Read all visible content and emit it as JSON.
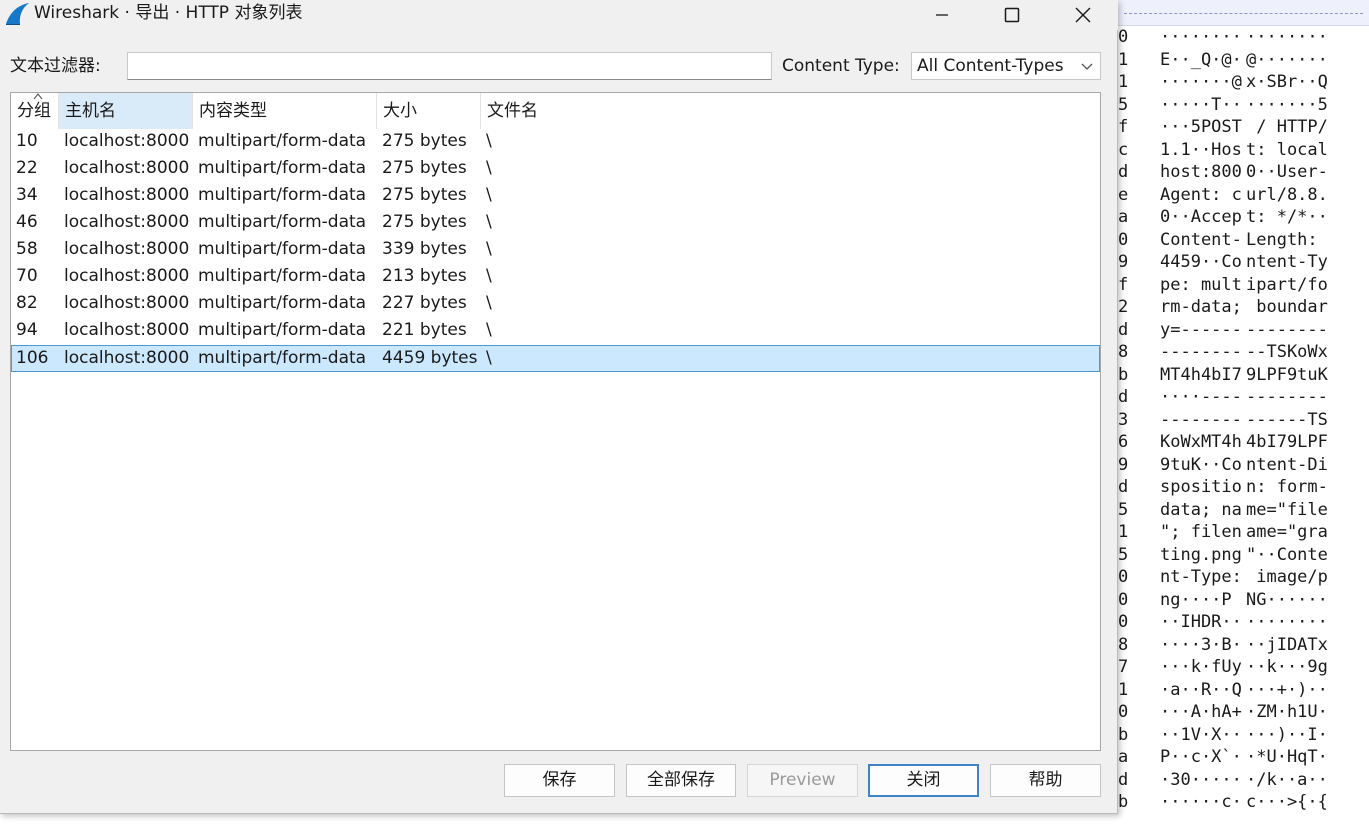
{
  "dialog": {
    "title": "Wireshark · 导出 · HTTP 对象列表",
    "filter_label": "文本过滤器:",
    "filter_value": "",
    "content_type_label": "Content Type:",
    "content_type_selected": "All Content-Types",
    "columns": [
      "分组",
      "主机名",
      "内容类型",
      "大小",
      "文件名"
    ],
    "rows": [
      {
        "packet": "10",
        "host": "localhost:8000",
        "type": "multipart/form-data",
        "size": "275 bytes",
        "filename": "\\"
      },
      {
        "packet": "22",
        "host": "localhost:8000",
        "type": "multipart/form-data",
        "size": "275 bytes",
        "filename": "\\"
      },
      {
        "packet": "34",
        "host": "localhost:8000",
        "type": "multipart/form-data",
        "size": "275 bytes",
        "filename": "\\"
      },
      {
        "packet": "46",
        "host": "localhost:8000",
        "type": "multipart/form-data",
        "size": "275 bytes",
        "filename": "\\"
      },
      {
        "packet": "58",
        "host": "localhost:8000",
        "type": "multipart/form-data",
        "size": "339 bytes",
        "filename": "\\"
      },
      {
        "packet": "70",
        "host": "localhost:8000",
        "type": "multipart/form-data",
        "size": "213 bytes",
        "filename": "\\"
      },
      {
        "packet": "82",
        "host": "localhost:8000",
        "type": "multipart/form-data",
        "size": "227 bytes",
        "filename": "\\"
      },
      {
        "packet": "94",
        "host": "localhost:8000",
        "type": "multipart/form-data",
        "size": "221 bytes",
        "filename": "\\"
      },
      {
        "packet": "106",
        "host": "localhost:8000",
        "type": "multipart/form-data",
        "size": "4459 bytes",
        "filename": "\\"
      }
    ],
    "selected_row": 8,
    "buttons": {
      "save": "保存",
      "save_all": "全部保存",
      "preview": "Preview",
      "close": "关闭",
      "help": "帮助"
    }
  },
  "hex_pane": {
    "lines": [
      {
        "off": "0",
        "a1": "········",
        "a2": "········"
      },
      {
        "off": "1",
        "a1": "E··_Q·@·",
        "a2": "@·······"
      },
      {
        "off": "1",
        "a1": "·······@",
        "a2": "x·SBr··Q"
      },
      {
        "off": "5",
        "a1": "·····T··",
        "a2": "·······5"
      },
      {
        "off": "f",
        "a1": "···5POST",
        "a2": " / HTTP/"
      },
      {
        "off": "c",
        "a1": "1.1··Hos",
        "a2": "t: local"
      },
      {
        "off": "d",
        "a1": "host:800",
        "a2": "0··User-"
      },
      {
        "off": "e",
        "a1": "Agent: c",
        "a2": "url/8.8."
      },
      {
        "off": "a",
        "a1": "0··Accep",
        "a2": "t: */*··"
      },
      {
        "off": "0",
        "a1": "Content-",
        "a2": "Length: "
      },
      {
        "off": "9",
        "a1": "4459··Co",
        "a2": "ntent-Ty"
      },
      {
        "off": "f",
        "a1": "pe: mult",
        "a2": "ipart/fo"
      },
      {
        "off": "2",
        "a1": "rm-data;",
        "a2": " boundar"
      },
      {
        "off": "d",
        "a1": "y=------",
        "a2": "--------"
      },
      {
        "off": "8",
        "a1": "--------",
        "a2": "--TSKoWx"
      },
      {
        "off": "b",
        "a1": "MT4h4bI7",
        "a2": "9LPF9tuK"
      },
      {
        "off": "d",
        "a1": "····----",
        "a2": "--------"
      },
      {
        "off": "3",
        "a1": "--------",
        "a2": "------TS"
      },
      {
        "off": "6",
        "a1": "KoWxMT4h",
        "a2": "4bI79LPF"
      },
      {
        "off": "9",
        "a1": "9tuK··Co",
        "a2": "ntent-Di"
      },
      {
        "off": "d",
        "a1": "spositio",
        "a2": "n: form-"
      },
      {
        "off": "5",
        "a1": "data; na",
        "a2": "me=\"file"
      },
      {
        "off": "1",
        "a1": "\"; filen",
        "a2": "ame=\"gra"
      },
      {
        "off": "5",
        "a1": "ting.png",
        "a2": "\"··Conte"
      },
      {
        "off": "0",
        "a1": "nt-Type:",
        "a2": " image/p"
      },
      {
        "off": "0",
        "a1": "ng····P",
        "a2": "NG······"
      },
      {
        "off": "0",
        "a1": "··IHDR··",
        "a2": "········"
      },
      {
        "off": "8",
        "a1": "····3·B·",
        "a2": "··jIDATx"
      },
      {
        "off": "7",
        "a1": "···k·fUy",
        "a2": "··k···9g"
      },
      {
        "off": "1",
        "a1": "·a··R··Q",
        "a2": "···+·)··"
      },
      {
        "off": "0",
        "a1": "···A·hA+",
        "a2": "·ZM·h1U·"
      },
      {
        "off": "b",
        "a1": "··1V·X··",
        "a2": "···)··I·"
      },
      {
        "off": "a",
        "a1": "P··c·X`·",
        "a2": "·*U·HqT·"
      },
      {
        "off": "d",
        "a1": "·30·····",
        "a2": "·/k··a··"
      },
      {
        "off": "b",
        "a1": "······c·",
        "a2": "c···>{·{"
      }
    ]
  },
  "colors": {
    "selection_bg": "#cce8ff",
    "selection_border": "#4a9ad8",
    "default_button_border": "#3f84c7",
    "sorted_header_bg": "#d9ebf9"
  }
}
